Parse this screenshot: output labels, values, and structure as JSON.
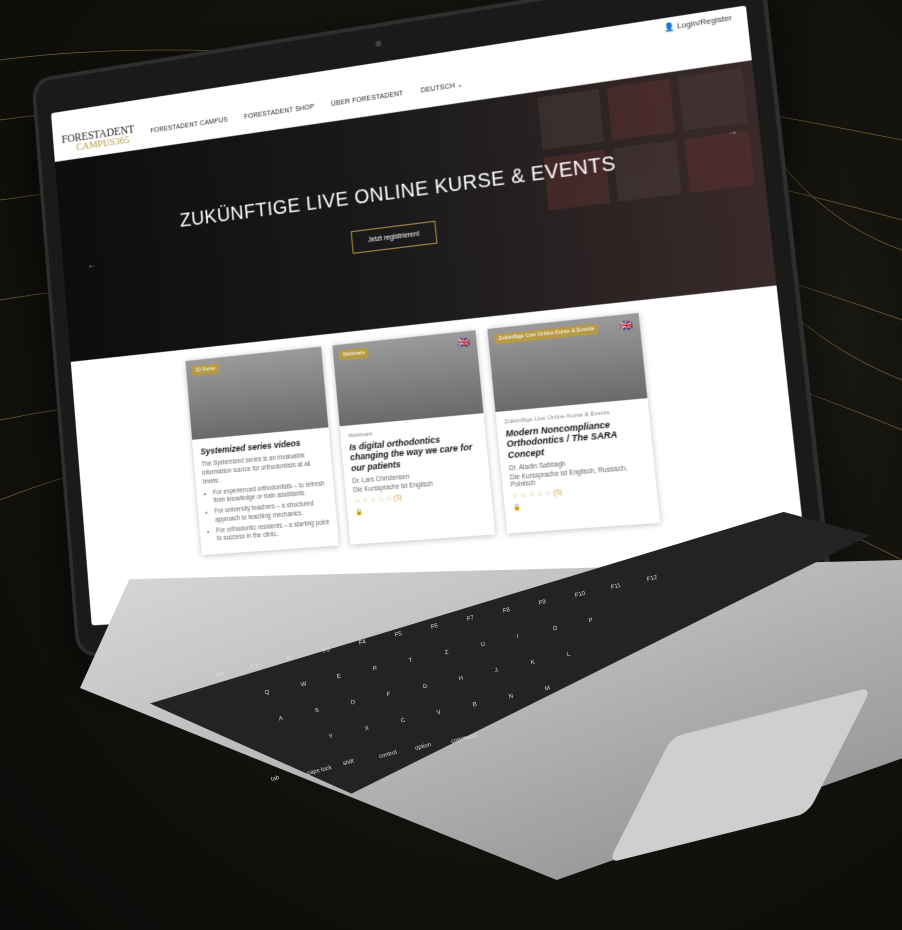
{
  "topbar": {
    "login_label": "Login/Register",
    "user_icon": "user-icon"
  },
  "nav": {
    "logo_main": "FORESTADENT",
    "logo_sub": "CAMPUS365",
    "items": [
      "FORESTADENT CAMPUS",
      "FORESTADENT SHOP",
      "ÜBER FORESTADENT",
      "DEUTSCH ⌄"
    ]
  },
  "hero": {
    "title": "ZUKÜNFTIGE LIVE ONLINE KURSE & EVENTS",
    "button": "Jetzt registrieren!",
    "prev": "←",
    "next": "→"
  },
  "cards": [
    {
      "badge": "10 Kurse",
      "title": "Systemized series videos",
      "intro": "The Systemized series is an invaluable information source for orthodontists at all levels:",
      "bullets": [
        "For experienced orthodontists – to refresh their knowledge or train assistants.",
        "For university teachers – a structured approach to teaching mechanics.",
        "For orthodontic residents – a starting point to success in the clinic."
      ]
    },
    {
      "badge": "Webinare",
      "flag": "🇬🇧",
      "category": "Webinare",
      "title": "Is digital orthodontics changing the way we care for our patients",
      "author": "Dr. Lars Christensen",
      "language": "Die Kurssprache ist Englisch",
      "rating": "☆ ☆ ☆ ☆ ☆ (0)",
      "lock": "🔒"
    },
    {
      "badge": "Zukünftige Live Online Kurse & Events",
      "flag": "🇬🇧",
      "category": "Zukünftige Live Online Kurse & Events",
      "title": "Modern Noncompliance Orthodontics / The SARA Concept",
      "author": "Dr. Aladin Sabbagh",
      "language": "Die Kurssprache ist Englisch, Russisch, Polnisch",
      "rating": "☆ ☆ ☆ ☆ ☆ (0)",
      "lock": "🔒"
    }
  ],
  "keyboard": {
    "keys": [
      "esc",
      "F1",
      "F2",
      "F3",
      "F4",
      "F5",
      "F6",
      "F7",
      "F8",
      "F9",
      "F10",
      "F11",
      "F12",
      "Q",
      "W",
      "E",
      "R",
      "T",
      "Z",
      "U",
      "I",
      "O",
      "P",
      "A",
      "S",
      "D",
      "F",
      "G",
      "H",
      "J",
      "K",
      "L",
      "Y",
      "X",
      "C",
      "V",
      "B",
      "N",
      "M",
      "tab",
      "caps lock",
      "shift",
      "control",
      "option",
      "command"
    ]
  },
  "colors": {
    "accent": "#b89a45",
    "hero_bg": "#111111"
  }
}
